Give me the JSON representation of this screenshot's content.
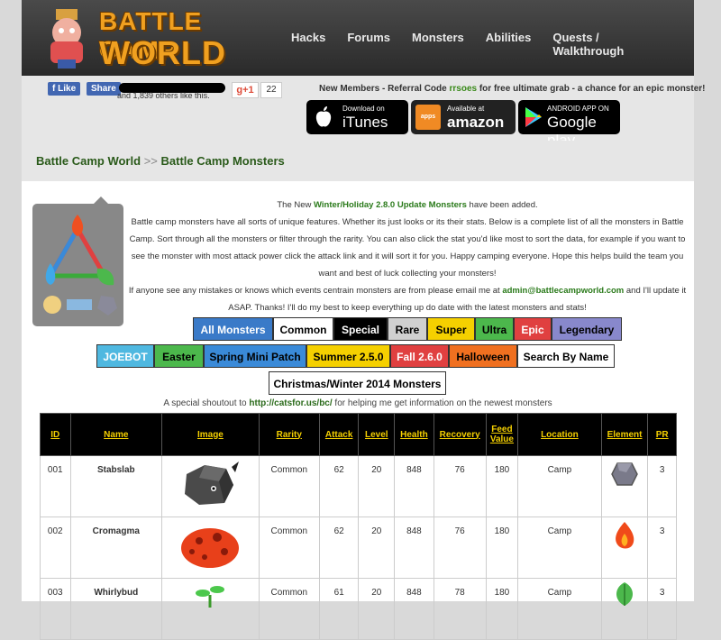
{
  "logo": {
    "line1": "BATTLE CAMP",
    "line2": "WORLD"
  },
  "nav": [
    "Hacks",
    "Forums",
    "Monsters",
    "Abilities",
    "Quests / Walkthrough"
  ],
  "social": {
    "like": "Like",
    "share": "Share",
    "likes_text": "and 1,839 others like this.",
    "gplus": "g+1",
    "gplus_count": "22"
  },
  "referral": {
    "prefix": "New Members - Referral Code ",
    "code": "rrsoes",
    "suffix": " for free ultimate grab - a chance for an epic monster!"
  },
  "stores": {
    "itunes": {
      "top": "Download on",
      "main": "iTunes"
    },
    "amazon": {
      "top": "Available at",
      "main": "amazon"
    },
    "google": {
      "top": "ANDROID APP ON",
      "main": "Google play"
    }
  },
  "breadcrumb": {
    "home": "Battle Camp World",
    "sep": ">>",
    "current": "Battle Camp Monsters"
  },
  "intro": {
    "line1_pre": "The New ",
    "line1_hl": "Winter/Holiday 2.8.0 Update Monsters",
    "line1_post": " have been added.",
    "body": "Battle camp monsters have all sorts of unique features. Whether its just looks or its their stats. Below is a complete list of all the monsters in Battle Camp. Sort through all the monsters or filter through the rarity. You can also click the stat you'd like most to sort the data, for example if you want to see the monster with most attack power click the attack link and it will sort it for you. Happy camping everyone. Hope this helps build the team you want and best of luck collecting your monsters!",
    "email_pre": "If anyone see any mistakes or knows which events centrain monsters are from please email me at ",
    "email": "admin@battlecampworld.com",
    "email_post": " and I'll update it ASAP. Thanks! I'll do my best to keep everything up do date with the latest monsters and stats!"
  },
  "rarity_buttons": [
    {
      "label": "All Monsters",
      "bg": "#3a7ac8",
      "fg": "#fff",
      "w": 89
    },
    {
      "label": "Common",
      "bg": "#ffffff",
      "fg": "#000",
      "w": 67
    },
    {
      "label": "Special",
      "bg": "#000000",
      "fg": "#fff",
      "w": 60
    },
    {
      "label": "Rare",
      "bg": "#d0d0d0",
      "fg": "#000",
      "w": 44
    },
    {
      "label": "Super",
      "bg": "#f5d000",
      "fg": "#000",
      "w": 53
    },
    {
      "label": "Ultra",
      "bg": "#4cb84c",
      "fg": "#000",
      "w": 43
    },
    {
      "label": "Epic",
      "bg": "#e04040",
      "fg": "#fff",
      "w": 42
    },
    {
      "label": "Legendary",
      "bg": "#8888cc",
      "fg": "#000",
      "w": 78
    }
  ],
  "event_buttons": [
    {
      "label": "JOEBOT",
      "bg": "#4fb8e0",
      "fg": "#fff",
      "w": 64
    },
    {
      "label": "Easter",
      "bg": "#4cb84c",
      "fg": "#000",
      "w": 55
    },
    {
      "label": "Spring Mini Patch",
      "bg": "#3a8ad8",
      "fg": "#000",
      "w": 114
    },
    {
      "label": "Summer 2.5.0",
      "bg": "#f5d000",
      "fg": "#000",
      "w": 93
    },
    {
      "label": "Fall 2.6.0",
      "bg": "#e04040",
      "fg": "#fff",
      "w": 65
    },
    {
      "label": "Halloween",
      "bg": "#f07020",
      "fg": "#000",
      "w": 76
    },
    {
      "label": "Search By Name",
      "bg": "#ffffff",
      "fg": "#000",
      "w": 108
    }
  ],
  "christmas_button": "Christmas/Winter 2014 Monsters",
  "shoutout": {
    "pre": "A special shoutout to ",
    "link": "http://catsfor.us/bc/",
    "post": " for helping me get information on the newest monsters"
  },
  "table": {
    "headers": [
      "ID",
      "Name",
      "Image",
      "Rarity",
      "Attack",
      "Level",
      "Health",
      "Recovery",
      "Feed Value",
      "Location",
      "Element",
      "PR"
    ],
    "rows": [
      {
        "id": "001",
        "name": "Stabslab",
        "rarity": "Common",
        "attack": "62",
        "level": "20",
        "health": "848",
        "recovery": "76",
        "feed": "180",
        "location": "Camp",
        "element": "rock-icon",
        "pr": "3"
      },
      {
        "id": "002",
        "name": "Cromagma",
        "rarity": "Common",
        "attack": "62",
        "level": "20",
        "health": "848",
        "recovery": "76",
        "feed": "180",
        "location": "Camp",
        "element": "fire-icon",
        "pr": "3"
      },
      {
        "id": "003",
        "name": "Whirlybud",
        "rarity": "Common",
        "attack": "61",
        "level": "20",
        "health": "848",
        "recovery": "78",
        "feed": "180",
        "location": "Camp",
        "element": "leaf-icon",
        "pr": "3"
      }
    ]
  }
}
